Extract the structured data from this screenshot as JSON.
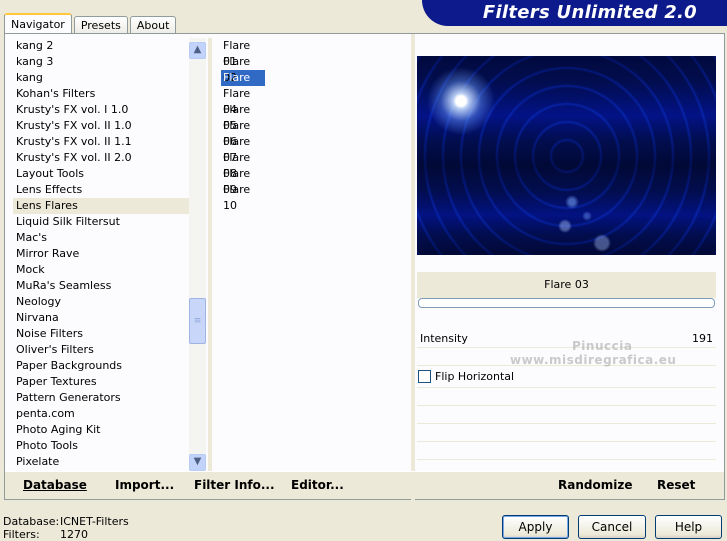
{
  "banner": {
    "title": "Filters Unlimited 2.0"
  },
  "tabs": [
    {
      "label": "Navigator",
      "active": true
    },
    {
      "label": "Presets",
      "active": false
    },
    {
      "label": "About",
      "active": false
    }
  ],
  "categories": {
    "items": [
      "kang 2",
      "kang 3",
      "kang",
      "Kohan's Filters",
      "Krusty's FX vol. I 1.0",
      "Krusty's FX vol. II 1.0",
      "Krusty's FX vol. II 1.1",
      "Krusty's FX vol. II 2.0",
      "Layout Tools",
      "Lens Effects",
      "Lens Flares",
      "Liquid Silk Filtersut",
      "Mac's",
      "Mirror Rave",
      "Mock",
      "MuRa's Seamless",
      "Neology",
      "Nirvana",
      "Noise Filters",
      "Oliver's Filters",
      "Paper Backgrounds",
      "Paper Textures",
      "Pattern Generators",
      "penta.com",
      "Photo Aging Kit",
      "Photo Tools",
      "Pixelate"
    ],
    "selected": "Lens Flares"
  },
  "filters": {
    "items": [
      "Flare 01",
      "Flare 02",
      "Flare 03",
      "Flare 04",
      "Flare 05",
      "Flare 06",
      "Flare 07",
      "Flare 08",
      "Flare 09",
      "Flare 10"
    ],
    "selected": "Flare 03"
  },
  "settings": {
    "filter_name": "Flare 03",
    "intensity_label": "Intensity",
    "intensity_value": "191",
    "flip_label": "Flip Horizontal",
    "flip_checked": false
  },
  "watermark": {
    "line1": "Pinuccia",
    "line2": "www.misdiregrafica.eu"
  },
  "toolbar": {
    "database": "Database",
    "import": "Import...",
    "filter_info": "Filter Info...",
    "editor": "Editor...",
    "randomize": "Randomize",
    "reset": "Reset"
  },
  "status": {
    "database_label": "Database:",
    "database_value": "ICNET-Filters",
    "filters_label": "Filters:",
    "filters_value": "1270"
  },
  "buttons": {
    "apply": "Apply",
    "cancel": "Cancel",
    "help": "Help"
  },
  "icons": {
    "scroll_up": "chevron-up-icon",
    "scroll_down": "chevron-down-icon",
    "scroll_grip": "grip-icon"
  }
}
